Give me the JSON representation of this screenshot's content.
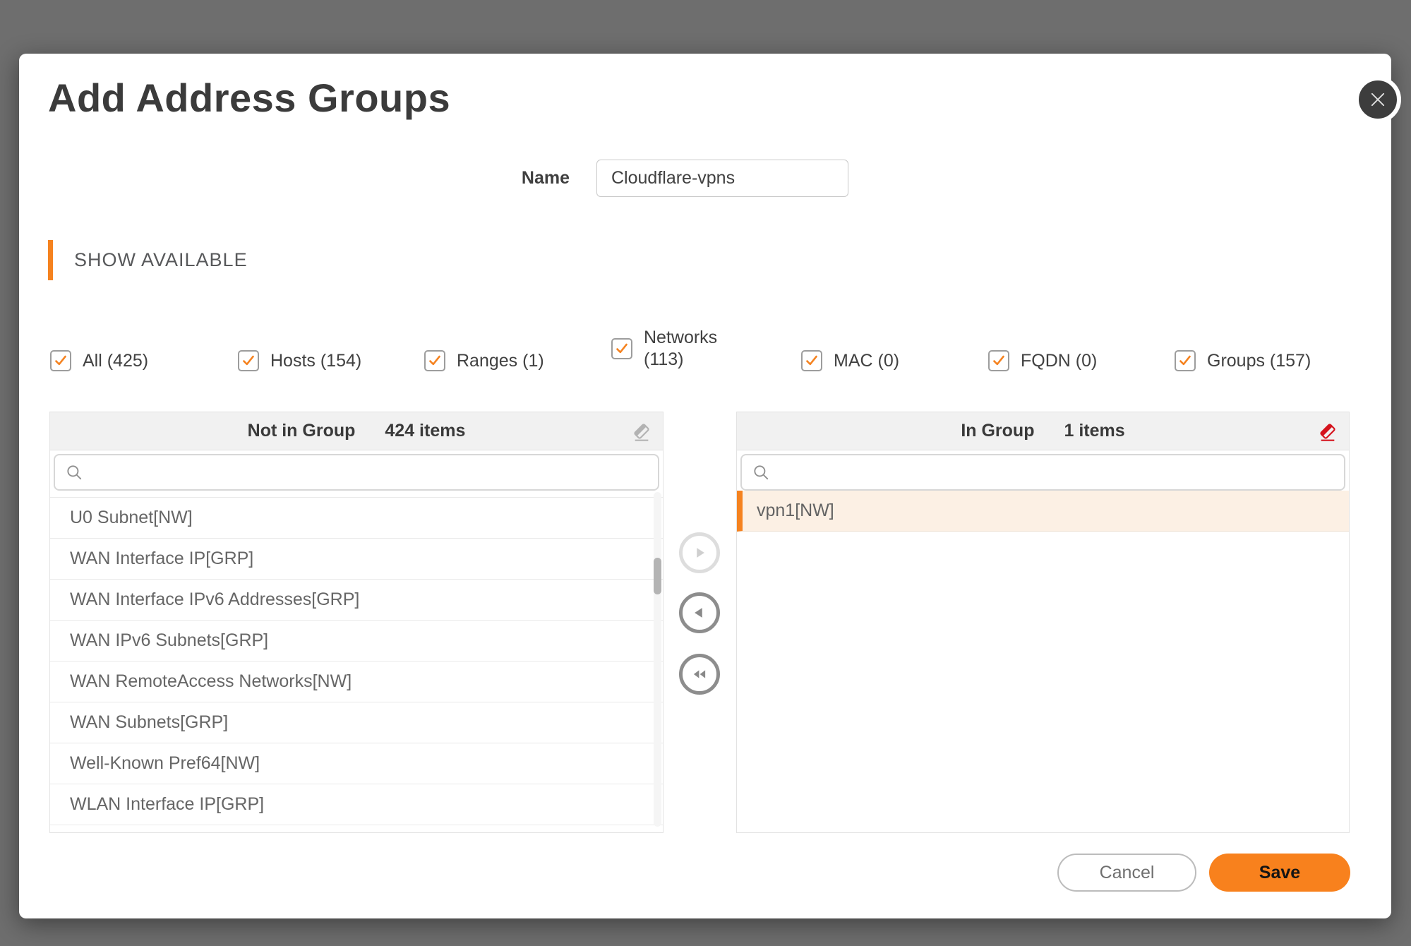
{
  "dialog": {
    "title": "Add Address Groups",
    "name_label": "Name",
    "name_value": "Cloudflare-vpns",
    "section_header": "SHOW AVAILABLE"
  },
  "filters": [
    {
      "label": "All (425)",
      "checked": true
    },
    {
      "label": "Hosts (154)",
      "checked": true
    },
    {
      "label": "Ranges (1)",
      "checked": true
    },
    {
      "label": "Networks",
      "label2": "(113)",
      "checked": true
    },
    {
      "label": "MAC (0)",
      "checked": true
    },
    {
      "label": "FQDN (0)",
      "checked": true
    },
    {
      "label": "Groups (157)",
      "checked": true
    }
  ],
  "not_in_group": {
    "title": "Not in Group",
    "count": "424 items",
    "search_placeholder": "",
    "items": [
      "U0 Subnet[NW]",
      "WAN Interface IP[GRP]",
      "WAN Interface IPv6 Addresses[GRP]",
      "WAN IPv6 Subnets[GRP]",
      "WAN RemoteAccess Networks[NW]",
      "WAN Subnets[GRP]",
      "Well-Known Pref64[NW]",
      "WLAN Interface IP[GRP]"
    ]
  },
  "in_group": {
    "title": "In Group",
    "count": "1 items",
    "search_placeholder": "",
    "items": [
      "vpn1[NW]"
    ]
  },
  "buttons": {
    "cancel": "Cancel",
    "save": "Save"
  },
  "icons": {
    "close": "close-icon",
    "search": "search-icon",
    "clear_list": "eraser-icon",
    "move_right": "arrow-right-circle-icon",
    "move_left": "arrow-left-circle-icon",
    "move_all_left": "double-arrow-left-circle-icon"
  },
  "colors": {
    "accent_orange": "#F5821F",
    "save_orange": "#F8811D",
    "eraser_red": "#D5131D",
    "selected_row_bg": "#FCF0E4",
    "overlay_gray": "#6E6E6E"
  }
}
